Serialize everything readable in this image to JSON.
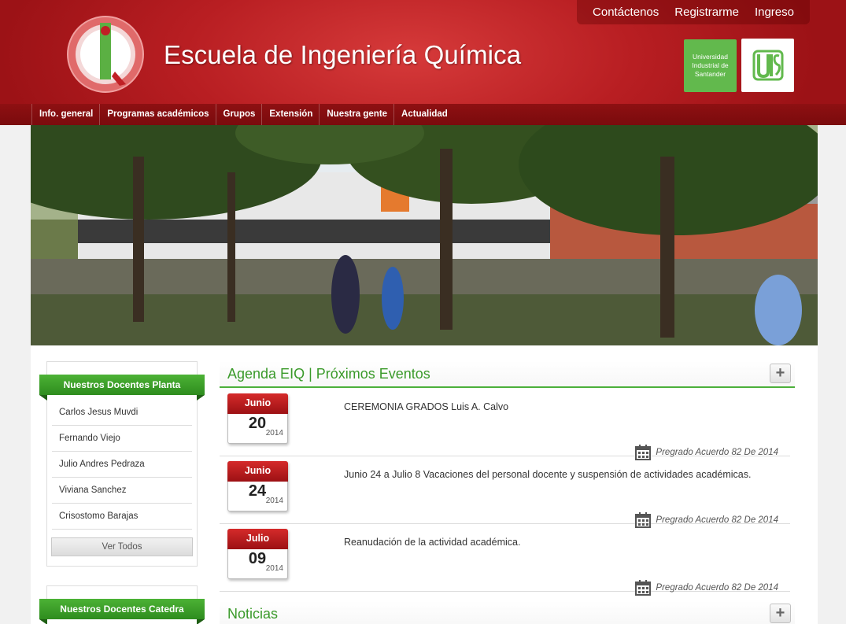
{
  "header": {
    "title": "Escuela de Ingeniería Química",
    "top_links": [
      "Contáctenos",
      "Registrarme",
      "Ingreso"
    ],
    "uis_text": [
      "Universidad",
      "Industrial de",
      "Santander"
    ],
    "accent": "#b81e22"
  },
  "nav": {
    "items": [
      "Info. general",
      "Programas académicos",
      "Grupos",
      "Extensión",
      "Nuestra gente",
      "Actualidad"
    ]
  },
  "sidebar": {
    "planta": {
      "title": "Nuestros Docentes Planta",
      "items": [
        "Carlos Jesus Muvdi",
        "Fernando Viejo",
        "Julio Andres Pedraza",
        "Viviana Sanchez",
        "Crisostomo Barajas"
      ],
      "button": "Ver Todos"
    },
    "catedra": {
      "title": "Nuestros Docentes Catedra"
    }
  },
  "agenda": {
    "title": "Agenda EIQ | Próximos Eventos",
    "plus": "+",
    "events": [
      {
        "month": "Junio",
        "day": "20",
        "year": "2014",
        "title": "CEREMONIA GRADOS Luis A. Calvo",
        "tag": "Pregrado Acuerdo 82 De 2014"
      },
      {
        "month": "Junio",
        "day": "24",
        "year": "2014",
        "title": "Junio 24 a Julio 8 Vacaciones del personal docente y suspensión de actividades académicas.",
        "tag": "Pregrado Acuerdo 82 De 2014"
      },
      {
        "month": "Julio",
        "day": "09",
        "year": "2014",
        "title": "Reanudación de la actividad académica.",
        "tag": "Pregrado Acuerdo 82 De 2014"
      }
    ]
  },
  "noticias": {
    "title": "Noticias",
    "plus": "+"
  },
  "colors": {
    "green": "#4bb03a",
    "calendar_red": "#c01f22"
  }
}
